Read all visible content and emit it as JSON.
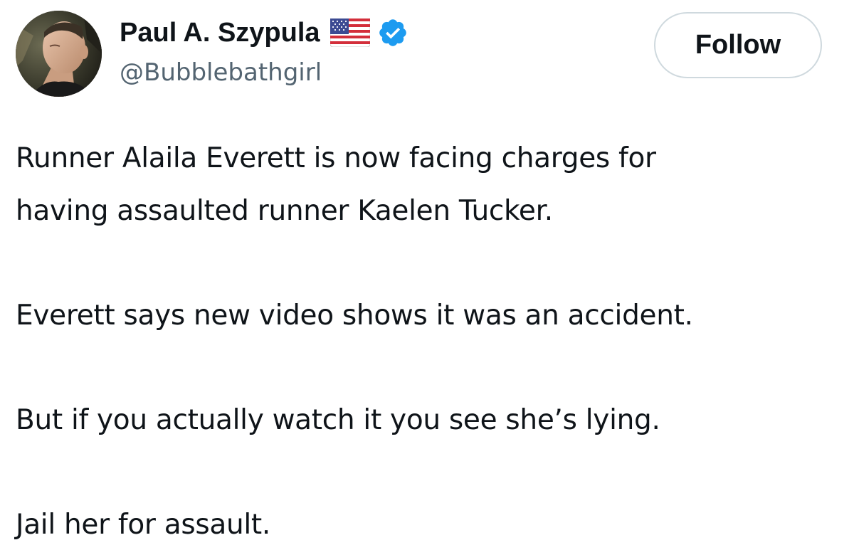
{
  "author": {
    "display_name": "Paul A. Szypula",
    "handle": "@Bubblebathgirl",
    "flag_icon": "us-flag-icon",
    "verified_icon": "verified-badge-icon",
    "verified_color": "#1d9bf0",
    "avatar_icon": "profile-photo"
  },
  "actions": {
    "follow_label": "Follow"
  },
  "tweet": {
    "lines": [
      "Runner Alaila Everett is now facing charges for",
      "having assaulted runner Kaelen Tucker.",
      "Everett says new video shows it was an accident.",
      "But if you actually watch it you see she’s lying.",
      "Jail her for assault."
    ]
  },
  "colors": {
    "text_primary": "#0f1419",
    "text_secondary": "#536471",
    "button_border": "#cfd9de"
  }
}
